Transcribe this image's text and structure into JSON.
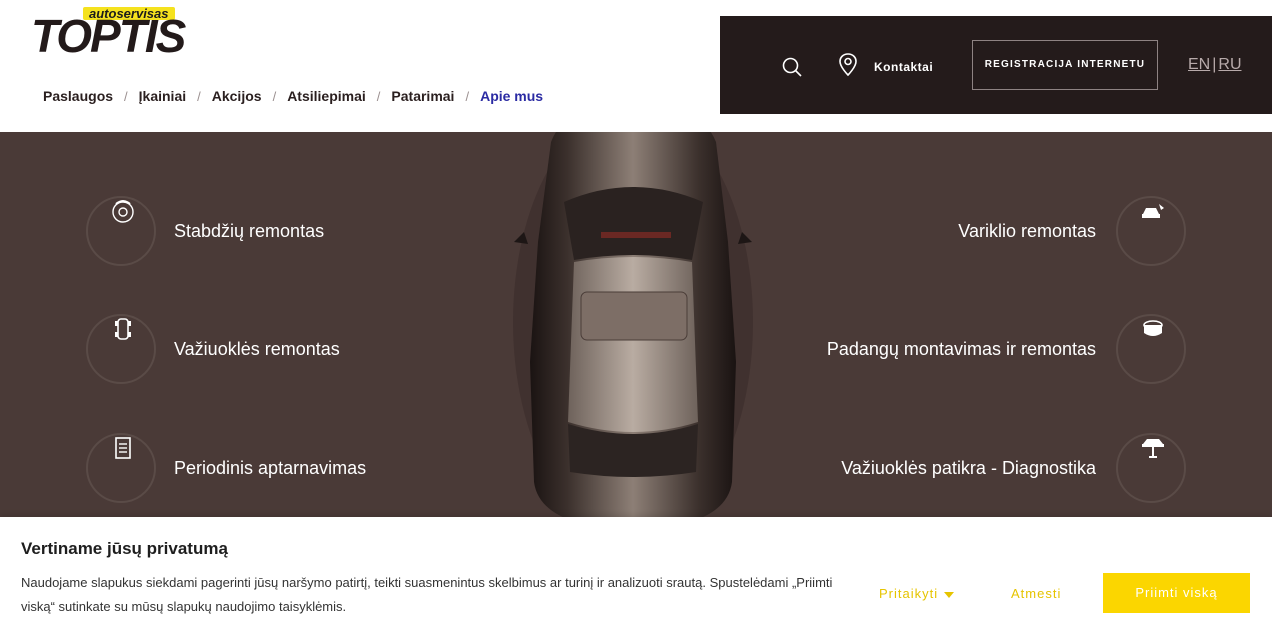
{
  "logo": {
    "badge": "autoservisas",
    "wordmark": "TOPTIS"
  },
  "nav": {
    "items": [
      {
        "label": "Paslaugos"
      },
      {
        "label": "Įkainiai"
      },
      {
        "label": "Akcijos"
      },
      {
        "label": "Atsiliepimai"
      },
      {
        "label": "Patarimai"
      },
      {
        "label": "Apie mus"
      }
    ],
    "active_color": "#2b2ba3"
  },
  "topbar": {
    "search_icon": "search-icon",
    "location_icon": "map-pin-icon",
    "contact_label": "Kontaktai",
    "register_label": "REGISTRACIJA INTERNETU",
    "lang_en": "EN",
    "lang_sep": "|",
    "lang_ru": "RU"
  },
  "services": {
    "left": [
      {
        "label": "Stabdžių remontas",
        "icon": "brake-disc-icon"
      },
      {
        "label": "Važiuoklės remontas",
        "icon": "chassis-icon"
      },
      {
        "label": "Periodinis aptarnavimas",
        "icon": "checklist-icon"
      }
    ],
    "right": [
      {
        "label": "Variklio remontas",
        "icon": "engine-car-icon"
      },
      {
        "label": "Padangų montavimas ir remontas",
        "icon": "tire-icon"
      },
      {
        "label": "Važiuoklės patikra - Diagnostika",
        "icon": "car-lift-icon"
      }
    ]
  },
  "cookie": {
    "title": "Vertiname jūsų privatumą",
    "text": "Naudojame slapukus siekdami pagerinti jūsų naršymo patirtį, teikti suasmenintus skelbimus ar turinį ir analizuoti srautą. Spustelėdami „Priimti viską“ sutinkate su mūsų slapukų naudojimo taisyklėmis.",
    "customize_label": "Pritaikyti",
    "reject_label": "Atmesti",
    "accept_label": "Priimti viską"
  },
  "colors": {
    "brand_yellow": "#fbd600",
    "hero_bg": "#4a3a37",
    "topbar_bg": "#241b1b"
  }
}
